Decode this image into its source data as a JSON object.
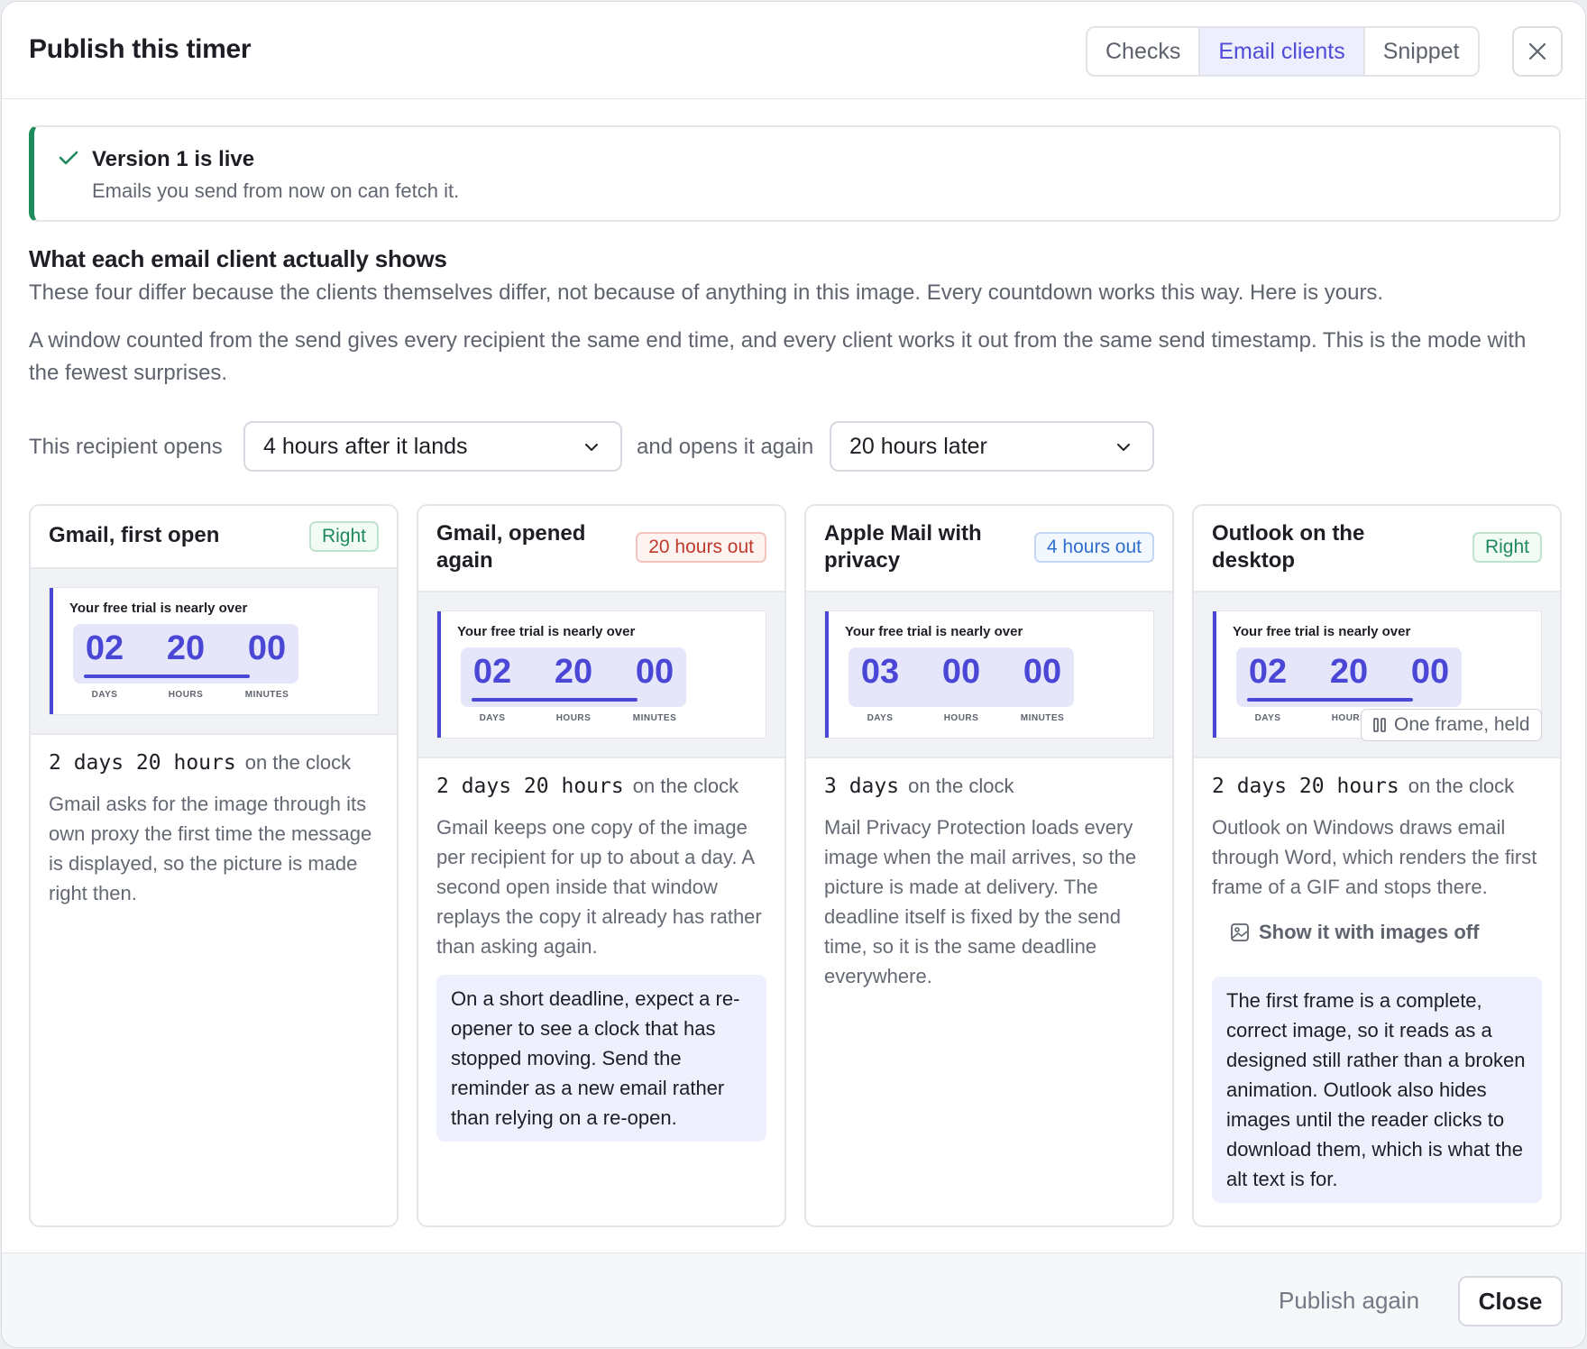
{
  "dialog": {
    "title": "Publish this timer"
  },
  "tabs": [
    {
      "label": "Checks",
      "active": false
    },
    {
      "label": "Email clients",
      "active": true
    },
    {
      "label": "Snippet",
      "active": false
    }
  ],
  "banner": {
    "title": "Version 1 is live",
    "subtitle": "Emails you send from now on can fetch it."
  },
  "section": {
    "title": "What each email client actually shows",
    "p1": "These four differ because the clients themselves differ, not because of anything in this image. Every countdown works this way. Here is yours.",
    "p2": "A window counted from the send gives every recipient the same end time, and every client works it out from the same send timestamp. This is the mode with the fewest surprises."
  },
  "selectors": {
    "opens_label": "This recipient opens",
    "opens_value": "4 hours after it lands",
    "again_label": "and opens it again",
    "again_value": "20 hours later"
  },
  "preview_text": "Your free trial is nearly over",
  "units": [
    "DAYS",
    "HOURS",
    "MINUTES"
  ],
  "clock_suffix": "on the clock",
  "cards": [
    {
      "title": "Gmail, first open",
      "badge": "Right",
      "badge_color": "#1f8a5b",
      "digits": [
        "02",
        "20",
        "00"
      ],
      "progress": 0.8,
      "clock": "2 days 20 hours",
      "desc": "Gmail asks for the image through its own proxy the first time the message is displayed, so the picture is made right then."
    },
    {
      "title": "Gmail, opened again",
      "badge": "20 hours out",
      "badge_color": "#c0392b",
      "digits": [
        "02",
        "20",
        "00"
      ],
      "progress": 0.8,
      "clock": "2 days 20 hours",
      "desc": "Gmail keeps one copy of the image per recipient for up to about a day. A second open inside that window replays the copy it already has rather than asking again.",
      "note": "On a short deadline, expect a re-opener to see a clock that has stopped moving. Send the reminder as a new email rather than relying on a re-open."
    },
    {
      "title": "Apple Mail with privacy",
      "badge": "4 hours out",
      "badge_color": "#2f6fce",
      "digits": [
        "03",
        "00",
        "00"
      ],
      "progress": 0,
      "clock": "3 days",
      "desc": "Mail Privacy Protection loads every image when the mail arrives, so the picture is made at delivery. The deadline itself is fixed by the send time, so it is the same deadline everywhere."
    },
    {
      "title": "Outlook on the desktop",
      "badge": "Right",
      "badge_color": "#1f8a5b",
      "digits": [
        "02",
        "20",
        "00"
      ],
      "progress": 0.8,
      "clock": "2 days 20 hours",
      "held_label": "One frame, held",
      "desc": "Outlook on Windows draws email through Word, which renders the first frame of a GIF and stops there.",
      "images_off_label": "Show it with images off",
      "note": "The first frame is a complete, correct image, so it reads as a designed still rather than a broken animation. Outlook also hides images until the reader clicks to download them, which is what the alt text is for."
    }
  ],
  "footer": {
    "publish_again": "Publish again",
    "close": "Close"
  },
  "icons": {
    "check": "check-icon",
    "close": "close-icon",
    "chevron": "chevron-down-icon",
    "pause": "pause-icon",
    "image": "image-icon"
  }
}
